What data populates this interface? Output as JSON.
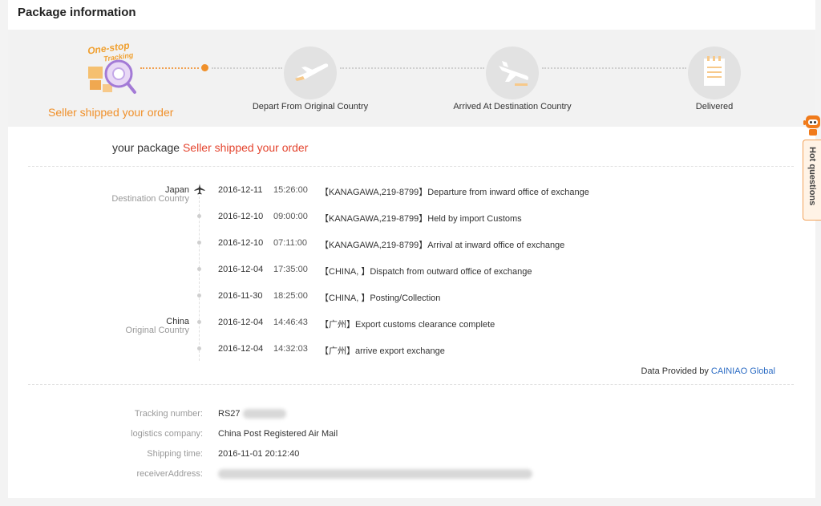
{
  "title": "Package information",
  "colors": {
    "accent": "#f0902a",
    "highlight": "#e4442e",
    "link": "#2c6cc4"
  },
  "banner": {
    "logo_line1": "One-stop",
    "logo_line2": "Tracking",
    "active_step": "Seller shipped your order",
    "steps": [
      {
        "label": "Depart From Original Country",
        "icon": "plane-departure-icon"
      },
      {
        "label": "Arrived At Destination Country",
        "icon": "plane-arrival-icon"
      },
      {
        "label": "Delivered",
        "icon": "document-icon"
      }
    ]
  },
  "status": {
    "prefix": "your package",
    "value": "Seller shipped your order"
  },
  "locations": {
    "destination": {
      "name": "Japan",
      "sub": "Destination Country"
    },
    "origin": {
      "name": "China",
      "sub": "Original Country"
    }
  },
  "events": [
    {
      "date": "2016-12-11",
      "time": "15:26:00",
      "desc": "【KANAGAWA,219-8799】Departure from inward office of exchange"
    },
    {
      "date": "2016-12-10",
      "time": "09:00:00",
      "desc": "【KANAGAWA,219-8799】Held by import Customs"
    },
    {
      "date": "2016-12-10",
      "time": "07:11:00",
      "desc": "【KANAGAWA,219-8799】Arrival at inward office of exchange"
    },
    {
      "date": "2016-12-04",
      "time": "17:35:00",
      "desc": "【CHINA, 】Dispatch from outward office of exchange"
    },
    {
      "date": "2016-11-30",
      "time": "18:25:00",
      "desc": "【CHINA, 】Posting/Collection"
    },
    {
      "date": "2016-12-04",
      "time": "14:46:43",
      "desc": "【广州】Export customs clearance complete"
    },
    {
      "date": "2016-12-04",
      "time": "14:32:03",
      "desc": "【广州】arrive export exchange"
    }
  ],
  "provider": {
    "prefix": "Data Provided by",
    "link": "CAINIAO Global"
  },
  "info": {
    "tracking_label": "Tracking number:",
    "tracking_value": "RS27",
    "company_label": "logistics company:",
    "company_value": "China Post Registered Air Mail",
    "shipping_label": "Shipping time:",
    "shipping_value": "2016-11-01 20:12:40",
    "address_label": "receiverAddress:"
  },
  "hot_questions": "Hot questions"
}
